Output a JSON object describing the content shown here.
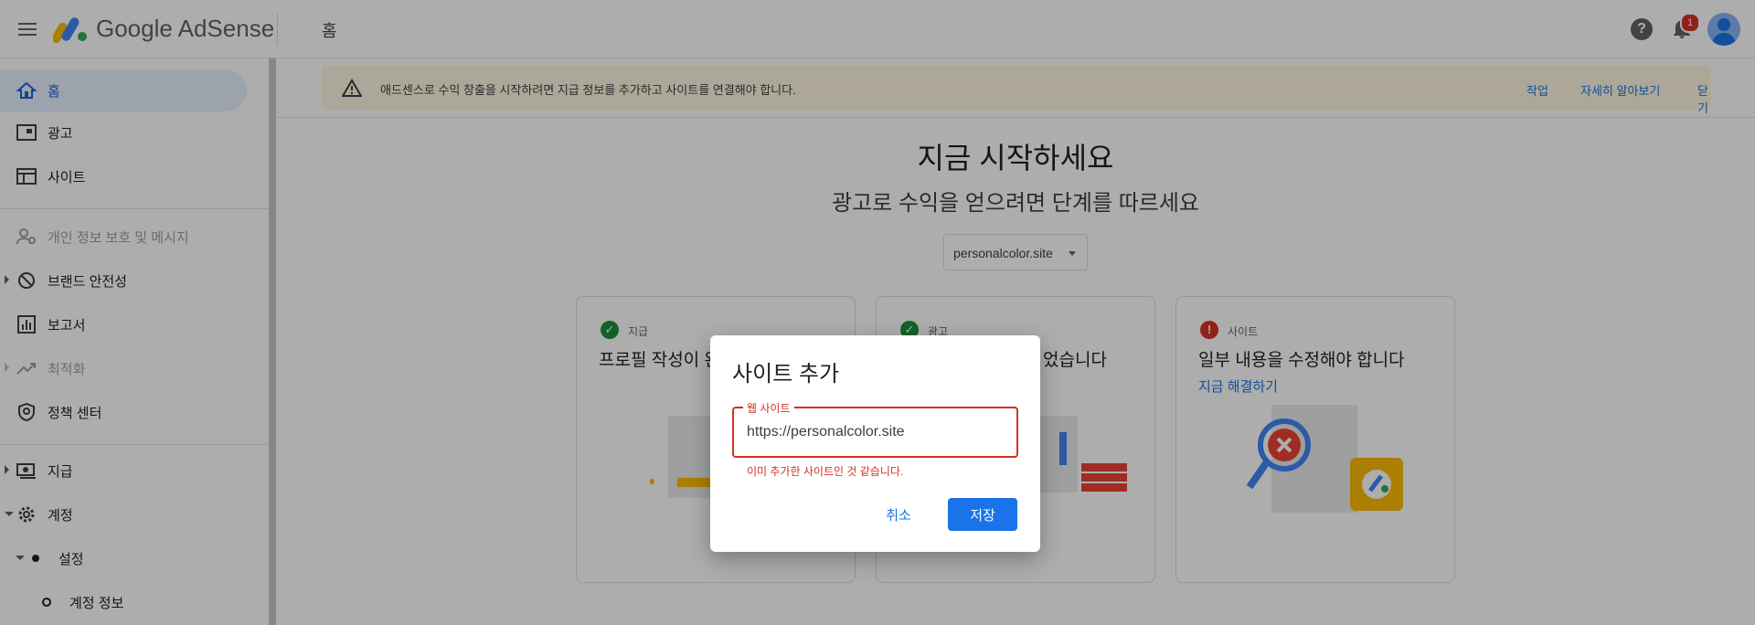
{
  "header": {
    "brand": "Google AdSense",
    "title": "홈",
    "notification_count": "1",
    "help_glyph": "?"
  },
  "sidebar": {
    "items": [
      {
        "label": "홈",
        "icon": "home-icon"
      },
      {
        "label": "광고",
        "icon": "ads-icon"
      },
      {
        "label": "사이트",
        "icon": "sites-icon"
      },
      {
        "label": "개인 정보 보호 및 메시지",
        "icon": "privacy-icon"
      },
      {
        "label": "브랜드 안전성",
        "icon": "block-icon"
      },
      {
        "label": "보고서",
        "icon": "reports-icon"
      },
      {
        "label": "최적화",
        "icon": "trending-icon"
      },
      {
        "label": "정책 센터",
        "icon": "policy-shield-icon"
      },
      {
        "label": "지급",
        "icon": "payments-icon"
      },
      {
        "label": "계정",
        "icon": "gear-icon"
      },
      {
        "label": "설정",
        "icon": "dot-icon"
      },
      {
        "label": "계정 정보",
        "icon": "circle-icon"
      }
    ]
  },
  "banner": {
    "text": "애드센스로 수익 창출을 시작하려면 지급 정보를 추가하고 사이트를 연결해야 합니다.",
    "link_action": "작업",
    "link_learn": "자세히 알아보기",
    "link_close": "닫기"
  },
  "main": {
    "title": "지금 시작하세요",
    "subtitle": "광고로 수익을 얻으려면 단계를 따르세요",
    "site_select": "personalcolor.site"
  },
  "cards": [
    {
      "category": "지급",
      "heading": "프로필 작성이 완",
      "status": "ok"
    },
    {
      "category": "광고",
      "heading": "었습니다",
      "status": "ok"
    },
    {
      "category": "사이트",
      "heading": "일부 내용을 수정해야 합니다",
      "link": "지금 해결하기",
      "status": "error"
    }
  ],
  "dialog": {
    "title": "사이트 추가",
    "field_label": "웹 사이트",
    "field_value": "https://personalcolor.site",
    "error": "이미 추가한 사이트인 것 같습니다.",
    "cancel": "취소",
    "save": "저장"
  },
  "colors": {
    "primary": "#1a73e8",
    "error": "#d93025",
    "success": "#1e8e3e",
    "banner_bg": "#fef7e0"
  }
}
